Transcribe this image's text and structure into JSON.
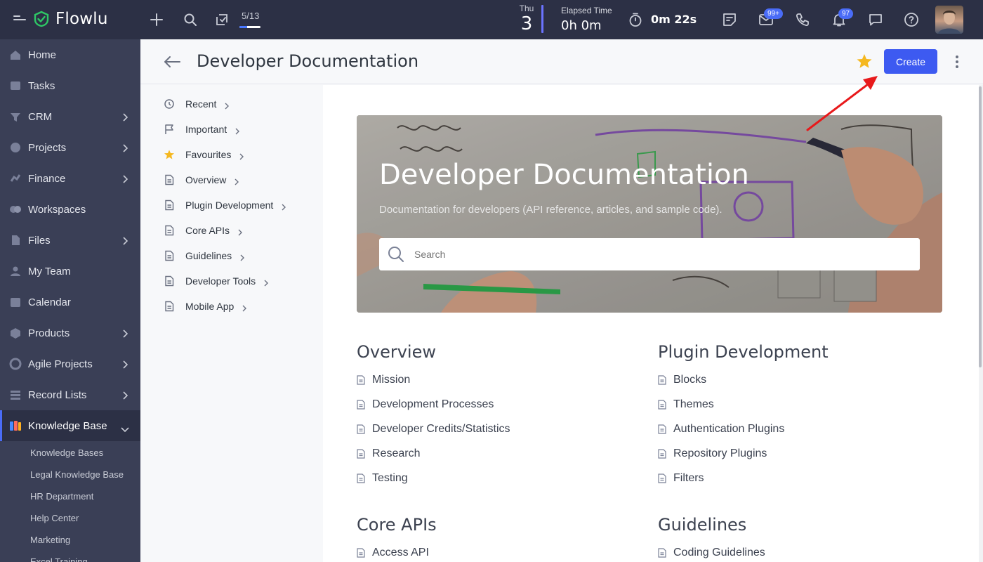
{
  "app": {
    "name": "Flowlu"
  },
  "topbar": {
    "task_counter": "5/13",
    "task_progress": 0.38,
    "day": "Thu",
    "date": "3",
    "elapsed_label": "Elapsed Time",
    "elapsed_value": "0h 0m",
    "timer_value": "0m 22s",
    "mail_badge": "99+",
    "notification_badge": "97",
    "icons": [
      "menu-icon",
      "add-icon",
      "search-icon",
      "task-check-icon",
      "stopwatch-icon",
      "notes-icon",
      "mail-icon",
      "phone-icon",
      "bell-icon",
      "chat-icon",
      "help-icon"
    ]
  },
  "sidebar": {
    "items": [
      {
        "label": "Home",
        "icon": "home-icon",
        "has_children": false
      },
      {
        "label": "Tasks",
        "icon": "tasks-icon",
        "has_children": false
      },
      {
        "label": "CRM",
        "icon": "crm-icon",
        "has_children": true
      },
      {
        "label": "Projects",
        "icon": "projects-icon",
        "has_children": true
      },
      {
        "label": "Finance",
        "icon": "finance-icon",
        "has_children": true
      },
      {
        "label": "Workspaces",
        "icon": "workspaces-icon",
        "has_children": false
      },
      {
        "label": "Files",
        "icon": "files-icon",
        "has_children": true
      },
      {
        "label": "My Team",
        "icon": "team-icon",
        "has_children": false
      },
      {
        "label": "Calendar",
        "icon": "calendar-icon",
        "has_children": false
      },
      {
        "label": "Products",
        "icon": "products-icon",
        "has_children": true
      },
      {
        "label": "Agile Projects",
        "icon": "agile-icon",
        "has_children": true
      },
      {
        "label": "Record Lists",
        "icon": "record-lists-icon",
        "has_children": true
      },
      {
        "label": "Knowledge Base",
        "icon": "knowledge-base-icon",
        "has_children": true,
        "active": true
      }
    ],
    "sub_items": [
      "Knowledge Bases",
      "Legal Knowledge Base",
      "HR Department",
      "Help Center",
      "Marketing",
      "Excel Training"
    ]
  },
  "header": {
    "title": "Developer Documentation",
    "create_label": "Create"
  },
  "subnav": {
    "items": [
      {
        "label": "Recent",
        "icon": "history-icon"
      },
      {
        "label": "Important",
        "icon": "flag-icon"
      },
      {
        "label": "Favourites",
        "icon": "star-icon"
      },
      {
        "label": "Overview",
        "icon": "document-icon"
      },
      {
        "label": "Plugin Development",
        "icon": "document-icon"
      },
      {
        "label": "Core APIs",
        "icon": "document-icon"
      },
      {
        "label": "Guidelines",
        "icon": "document-icon"
      },
      {
        "label": "Developer Tools",
        "icon": "document-icon"
      },
      {
        "label": "Mobile App",
        "icon": "document-icon"
      }
    ]
  },
  "hero": {
    "title": "Developer Documentation",
    "subtitle": "Documentation for developers (API reference, articles, and sample code).",
    "search_placeholder": "Search"
  },
  "sections": [
    {
      "title": "Overview",
      "links": [
        "Mission",
        "Development Processes",
        "Developer Credits/Statistics",
        "Research",
        "Testing"
      ]
    },
    {
      "title": "Plugin Development",
      "links": [
        "Blocks",
        "Themes",
        "Authentication Plugins",
        "Repository Plugins",
        "Filters"
      ]
    },
    {
      "title": "Core APIs",
      "links": [
        "Access API"
      ]
    },
    {
      "title": "Guidelines",
      "links": [
        "Coding Guidelines"
      ]
    }
  ],
  "colors": {
    "accent": "#3d5af1",
    "sidebar_bg": "#3a3f56",
    "topbar_bg": "#2c3045",
    "star": "#f5b820",
    "annotation_arrow": "#e8191b"
  }
}
